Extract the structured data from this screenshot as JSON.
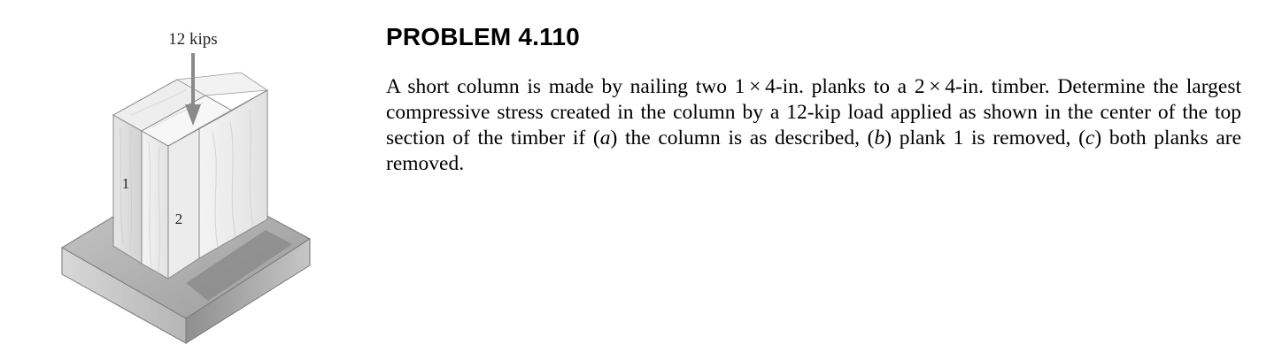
{
  "figure": {
    "load_label": "12 kips",
    "plank1_label": "1",
    "plank2_label": "2"
  },
  "problem": {
    "title": "PROBLEM 4.110",
    "text_1": "A short column is made by nailing two 1 × 4-in. planks to a 2 × 4-in. timber. Determine the largest compressive stress created in the column by a 12-kip load applied as shown in the center of the top section of the timber if (",
    "part_a": "a",
    "text_2": ") the column is as described, (",
    "part_b": "b",
    "text_3": ") plank 1 is removed, (",
    "part_c": "c",
    "text_4": ") both planks are removed."
  }
}
